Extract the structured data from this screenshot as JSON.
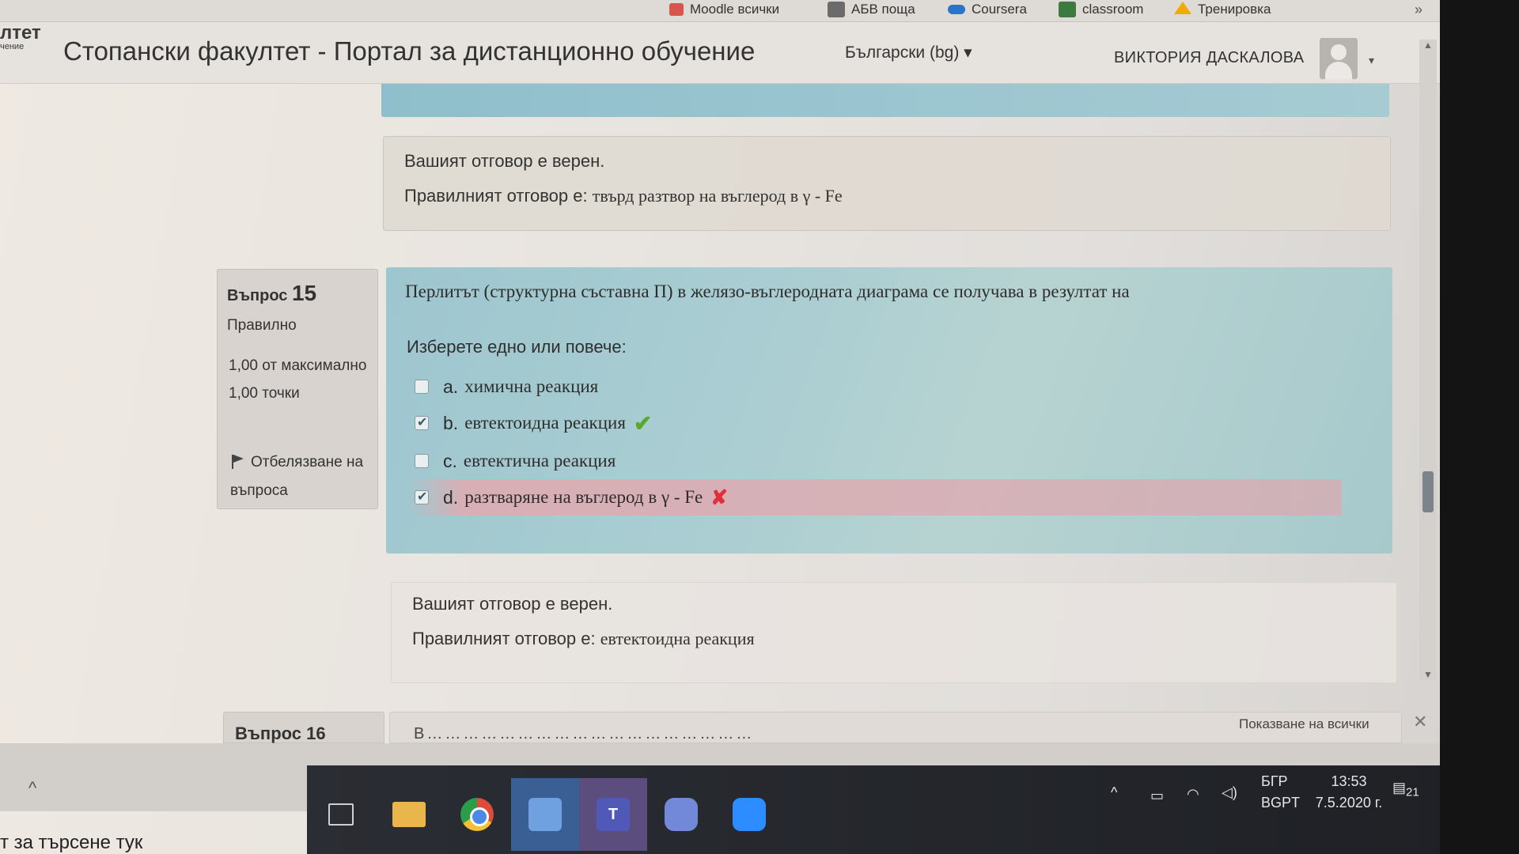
{
  "bookmarks": [
    {
      "label": "Moodle всички",
      "icon": "moodle-icon",
      "color": "#d9534f"
    },
    {
      "label": "АБВ поща",
      "icon": "mail-icon",
      "color": "#6b6b6b"
    },
    {
      "label": "Coursera",
      "icon": "coursera-icon",
      "color": "#2a73cc"
    },
    {
      "label": "classroom",
      "icon": "classroom-icon",
      "color": "#3d7a3d"
    },
    {
      "label": "Тренировка",
      "icon": "drive-icon",
      "color": "#f2a900"
    }
  ],
  "bookmarks_more": "»",
  "header": {
    "logo_line1": "лтет",
    "logo_line2": "чение",
    "site_title": "Стопански факултет - Портал за дистанционно обучение",
    "language": "Български (bg) ▾",
    "user_name": "ВИКТОРИЯ ДАСКАЛОВА",
    "user_caret": "▾"
  },
  "prev_feedback": {
    "line1": "Вашият отговор е верен.",
    "line2_prefix": "Правилният отговор е: ",
    "line2_answer": "твърд разтвор на въглерод в γ - Fe"
  },
  "question": {
    "label": "Въпрос",
    "number": "15",
    "state": "Правилно",
    "grade": "1,00 от максимално 1,00 точки",
    "flag_label": "Отбелязване на въпроса",
    "text": "Перлитът (структурна съставна П) в желязо-въглеродната диаграма се получава в резултат на",
    "prompt": "Изберете едно или повече:",
    "answers": [
      {
        "letter": "a.",
        "text": "химична реакция",
        "checked": false,
        "mark": ""
      },
      {
        "letter": "b.",
        "text": "евтектоидна реакция",
        "checked": true,
        "mark": "correct"
      },
      {
        "letter": "c.",
        "text": "евтектична реакция",
        "checked": false,
        "mark": ""
      },
      {
        "letter": "d.",
        "text": "разтваряне на въглерод в γ - Fe",
        "checked": true,
        "mark": "incorrect"
      }
    ],
    "mark_correct": "✔",
    "mark_incorrect": "✘"
  },
  "feedback": {
    "line1": "Вашият отговор е верен.",
    "line2_prefix": "Правилният отговор е: ",
    "line2_answer": "евтектоидна реакция"
  },
  "next_question": {
    "label": "Въпрос 16",
    "text_fragment": "В………………………………………………"
  },
  "downloads": {
    "show_all": "Показване на всички",
    "close": "✕",
    "expand": "^"
  },
  "tray": {
    "lang1": "БГР",
    "lang2": "BGPT",
    "time": "13:53",
    "date": "7.5.2020 г.",
    "notifications": "21"
  },
  "taskbar_search": "т за търсене тук",
  "colors": {
    "question_bg": "#a9cdd2",
    "correct": "#5aa82e",
    "incorrect": "#e0303a",
    "incorrect_row": "#e2aab0"
  }
}
